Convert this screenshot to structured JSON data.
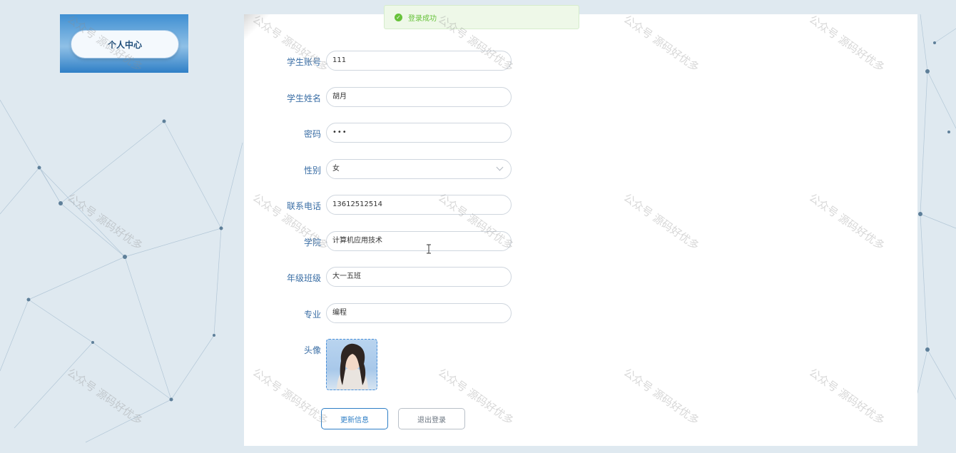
{
  "side_menu": {
    "item_label": "个人中心"
  },
  "toast": {
    "message": "登录成功"
  },
  "form": {
    "account_label": "学生账号",
    "account_value": "111",
    "name_label": "学生姓名",
    "name_value": "胡月",
    "password_label": "密码",
    "password_value": "•••",
    "gender_label": "性别",
    "gender_value": "女",
    "phone_label": "联系电话",
    "phone_value": "13612512514",
    "college_label": "学院",
    "college_value": "计算机应用技术",
    "class_label": "年级班级",
    "class_value": "大一五班",
    "major_label": "专业",
    "major_value": "编程",
    "avatar_label": "头像"
  },
  "buttons": {
    "update": "更新信息",
    "logout": "退出登录"
  },
  "watermark": "公众号 源码好优多",
  "colors": {
    "accent": "#2f7fc6",
    "success": "#67c23a",
    "label": "#3a6ea5"
  }
}
